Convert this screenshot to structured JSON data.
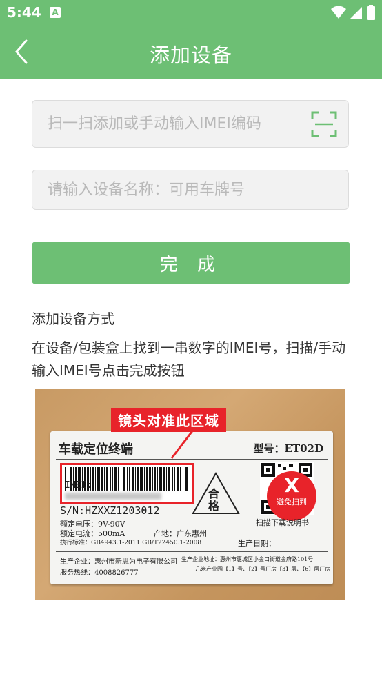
{
  "status_bar": {
    "time": "5:44",
    "notification": "A"
  },
  "nav": {
    "title": "添加设备"
  },
  "form": {
    "scan_placeholder": "扫一扫添加或手动输入IMEI编码",
    "name_placeholder": "请输入设备名称：可用车牌号",
    "done_label": "完 成"
  },
  "instructions": {
    "title": "添加设备方式",
    "description": "在设备/包装盒上找到一串数字的IMEI号，扫描/手动输入IMEI号点击完成按钮"
  },
  "example_label": {
    "callout": "镜头对准此区域",
    "title": "车载定位终端",
    "model": "型号：ET02D",
    "imei_prefix": "IMEI:",
    "cert_mark": "合格",
    "serial": "S/N:HZXXZ1203012",
    "rated_voltage": "额定电压：9V-90V",
    "rated_current": "额定电流：500mA",
    "origin": "产地：广东惠州",
    "standard": "执行标准：GB4943.1-2011 GB/T22450.1-2008",
    "production_date_label": "生产日期：",
    "qr_caption": "扫描下载说明书",
    "avoid_x": "X",
    "avoid_text": "避免扫到",
    "manufacturer": "生产企业：惠州市新思为电子有限公司",
    "hotline": "服务热线：4008826777",
    "address": "生产企业地址：惠州市惠城区小金口街道金府路101号",
    "address2": "几米产业园【1】号、【2】号厂房【3】层、【6】层厂房"
  }
}
